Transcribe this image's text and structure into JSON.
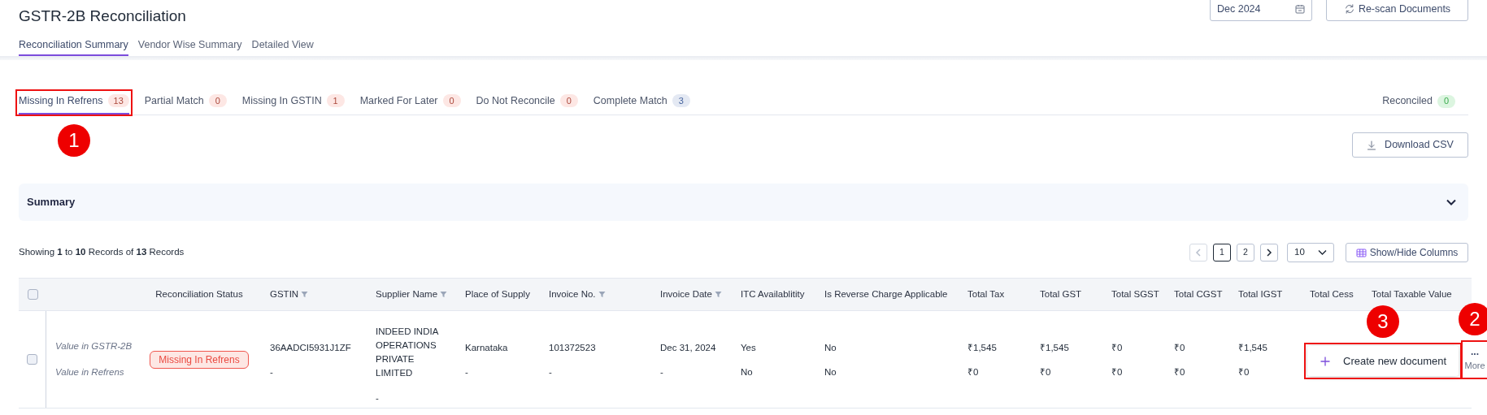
{
  "page_title": "GSTR-2B Reconciliation",
  "period_field": {
    "value": "Dec 2024"
  },
  "rescan_button": "Re-scan Documents",
  "view_tabs": [
    {
      "label": "Reconciliation Summary",
      "selected": true
    },
    {
      "label": "Vendor Wise Summary",
      "selected": false
    },
    {
      "label": "Detailed View",
      "selected": false
    }
  ],
  "status_tabs": [
    {
      "label": "Missing In Refrens",
      "count": "13",
      "color": "#fde7e4",
      "selected": true,
      "annotation": {
        "label": "1"
      }
    },
    {
      "label": "Partial Match",
      "count": "0",
      "color": "#fde7e4",
      "selected": false
    },
    {
      "label": "Missing In GSTIN",
      "count": "1",
      "color": "#fde7e4",
      "selected": false
    },
    {
      "label": "Marked For Later",
      "count": "0",
      "color": "#fde7e4",
      "selected": false
    },
    {
      "label": "Do Not Reconcile",
      "count": "0",
      "color": "#fde7e4",
      "selected": false
    },
    {
      "label": "Complete Match",
      "count": "3",
      "color": "#e4e9f3",
      "selected": false
    }
  ],
  "reconciled": {
    "label": "Reconciled",
    "count": "0",
    "color": "#dcf5e0"
  },
  "download_button": "Download CSV",
  "summary": {
    "title": "Summary",
    "expanded": false
  },
  "records_text": "Showing **1** to **10** Records of **13** Records",
  "pagination": {
    "pages": [
      {
        "label": "1",
        "selected": true
      },
      {
        "label": "2",
        "selected": false
      }
    ],
    "page_size": "10"
  },
  "columns_button": "Show/Hide Columns",
  "table": {
    "select_all_checked": false,
    "columns": [
      {
        "label": "Reconciliation Status",
        "filter": false
      },
      {
        "label": "GSTIN",
        "filter": true
      },
      {
        "label": "Supplier Name",
        "filter": true
      },
      {
        "label": "Place of Supply",
        "filter": false
      },
      {
        "label": "Invoice No.",
        "filter": true
      },
      {
        "label": "Invoice Date",
        "filter": true
      },
      {
        "label": "ITC Availablitity",
        "filter": false
      },
      {
        "label": "Is Reverse Charge Applicable",
        "filter": false
      },
      {
        "label": "Total Tax",
        "filter": false
      },
      {
        "label": "Total GST",
        "filter": false
      },
      {
        "label": "Total SGST",
        "filter": false
      },
      {
        "label": "Total CGST",
        "filter": false
      },
      {
        "label": "Total IGST",
        "filter": false
      },
      {
        "label": "Total Cess",
        "filter": false
      },
      {
        "label": "Total Taxable Value",
        "filter": false
      }
    ],
    "rows": [
      {
        "checked": false,
        "labels": [
          "Value in GSTR-2B",
          "Value in Refrens"
        ],
        "cells": [
          [
            "Missing In Refrens"
          ],
          [
            "36AADCI5931J1ZF",
            "-"
          ],
          [
            "INDEED INDIA OPERATIONS PRIVATE LIMITED",
            "-"
          ],
          [
            "Karnataka",
            "-"
          ],
          [
            "101372523",
            "-"
          ],
          [
            "Dec 31, 2024",
            "-"
          ],
          [
            "Yes",
            "No"
          ],
          [
            "No",
            "No"
          ],
          [
            "₹1,545",
            "₹0"
          ],
          [
            "₹1,545",
            "₹0"
          ],
          [
            "₹0",
            "₹0"
          ],
          [
            "₹0",
            "₹0"
          ],
          [
            "₹1,545",
            "₹0"
          ]
        ],
        "popup": {
          "label": "Create new document",
          "annotation": {
            "label": "3"
          }
        },
        "more": {
          "dots": "...",
          "label": "More",
          "annotation": {
            "label": "2"
          }
        }
      }
    ]
  }
}
